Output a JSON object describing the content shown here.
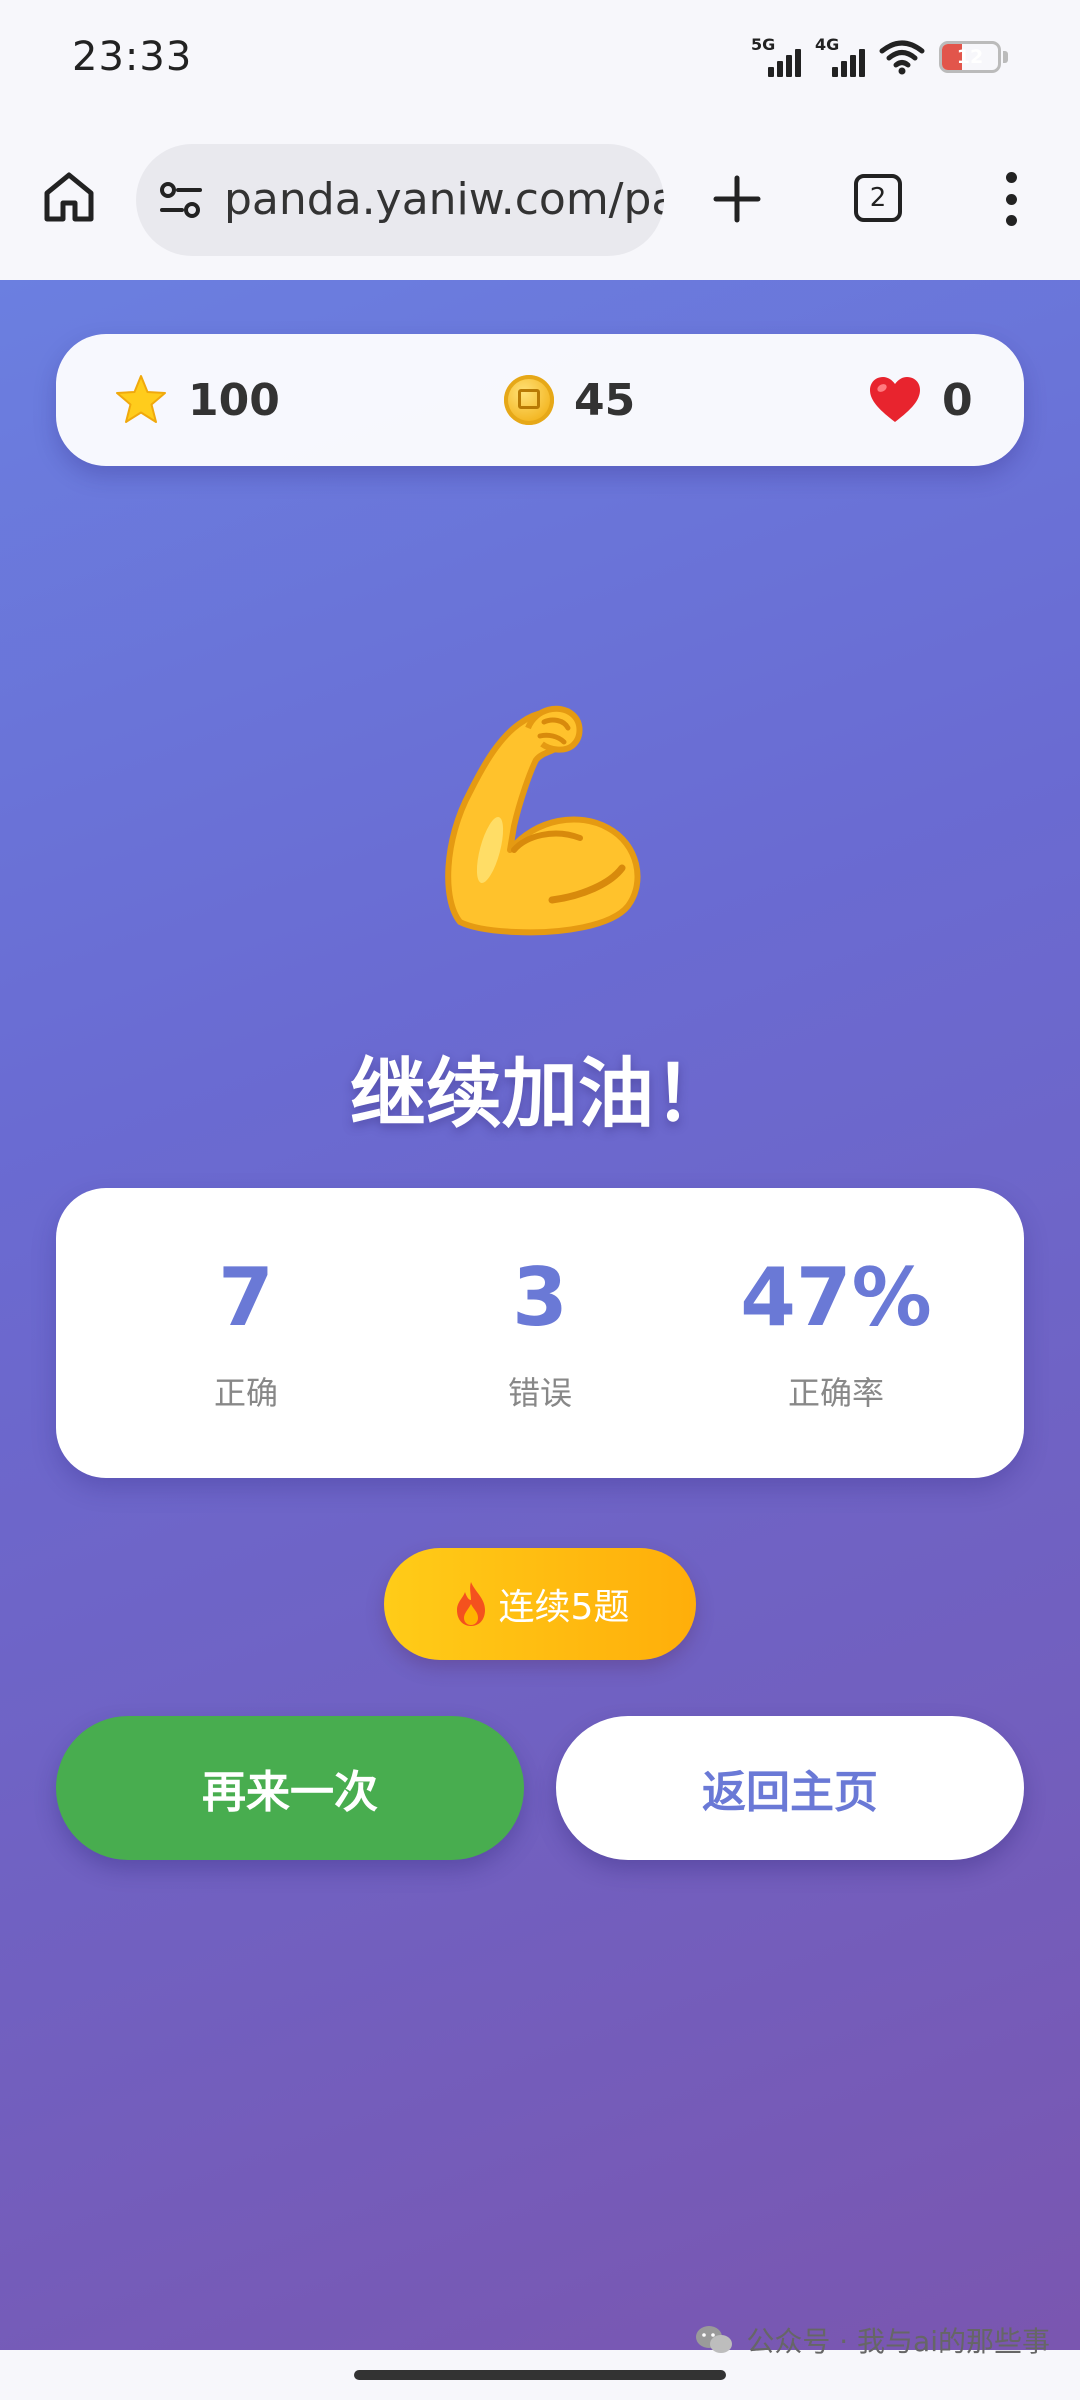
{
  "status_bar": {
    "time": "23:33",
    "network_1": "5G",
    "network_2": "4G",
    "battery_level": "12",
    "battery_fraction": 0.12
  },
  "browser": {
    "url": "panda.yaniw.com/pa",
    "tab_count": "2",
    "icons": [
      "home-icon",
      "site-settings-icon",
      "plus-icon",
      "tabs-icon",
      "more-vert-icon"
    ]
  },
  "stats": {
    "stars": "100",
    "coins": "45",
    "hearts": "0"
  },
  "result": {
    "emoji": "flexed-biceps",
    "title": "继续加油！"
  },
  "score": {
    "correct_value": "7",
    "correct_label": "正确",
    "wrong_value": "3",
    "wrong_label": "错误",
    "rate_value": "47%",
    "rate_label": "正确率"
  },
  "streak": {
    "label": "连续5题"
  },
  "buttons": {
    "retry": "再来一次",
    "home": "返回主页"
  },
  "watermark": {
    "text": "公众号 · 我与ai的那些事"
  },
  "colors": {
    "accent_blue": "#6a79d6",
    "retry_green": "#48ad4f",
    "streak_yellow": "#ffbe12",
    "gradient_start": "#6b7fe0",
    "gradient_end": "#7a56b0"
  }
}
